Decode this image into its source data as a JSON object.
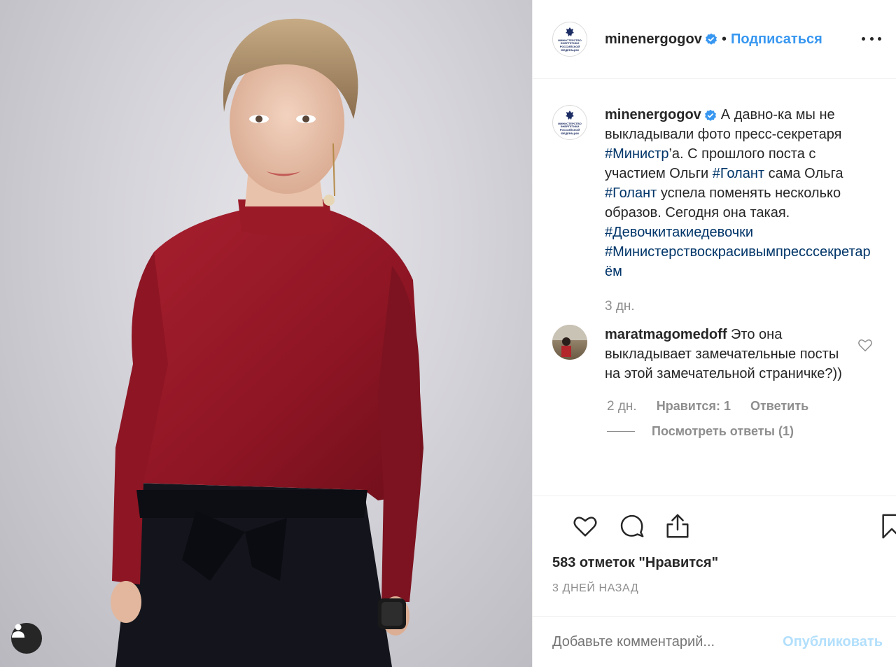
{
  "post": {
    "username": "minenergogov",
    "follow_label": "Подписаться",
    "separator": "•",
    "avatar_text": "Министерство энергетики российской федерации",
    "caption": {
      "username": "minenergogov",
      "text_1": "А давно-ка мы не выкладывали фото пресс-секретаря ",
      "tag_1": "#Министр",
      "text_2": "’а. С прошлого поста с участием Ольги ",
      "tag_2": "#Голант",
      "text_3": " сама Ольга ",
      "tag_3": "#Голант",
      "text_4": " успела поменять несколько образов. Сегодня она такая.",
      "tag_4": "#Девочкитакиедевочки",
      "tag_5": "#Министерствоскрасивымпресссекретарём",
      "time": "3 дн."
    },
    "comment": {
      "username": "maratmagomedoff",
      "text": " Это она выкладывает замечательные посты на этой замечательной страничке?))",
      "time": "2 дн.",
      "likes": "Нравится: 1",
      "reply": "Ответить",
      "view_replies": "Посмотреть ответы (1)"
    },
    "likes_count": "583 отметок \"Нравится\"",
    "timestamp": "3 ДНЕЙ НАЗАД",
    "add_comment_placeholder": "Добавьте комментарий...",
    "publish_label": "Опубликовать"
  },
  "colors": {
    "link": "#3897f0",
    "hashtag": "#003569",
    "muted": "#8e8e8e",
    "publish_disabled": "#b2dffc"
  },
  "icons": [
    "user-tag-icon",
    "verified-badge-icon",
    "more-options-icon",
    "heart-icon",
    "comment-icon",
    "share-icon",
    "bookmark-icon",
    "small-heart-icon"
  ]
}
